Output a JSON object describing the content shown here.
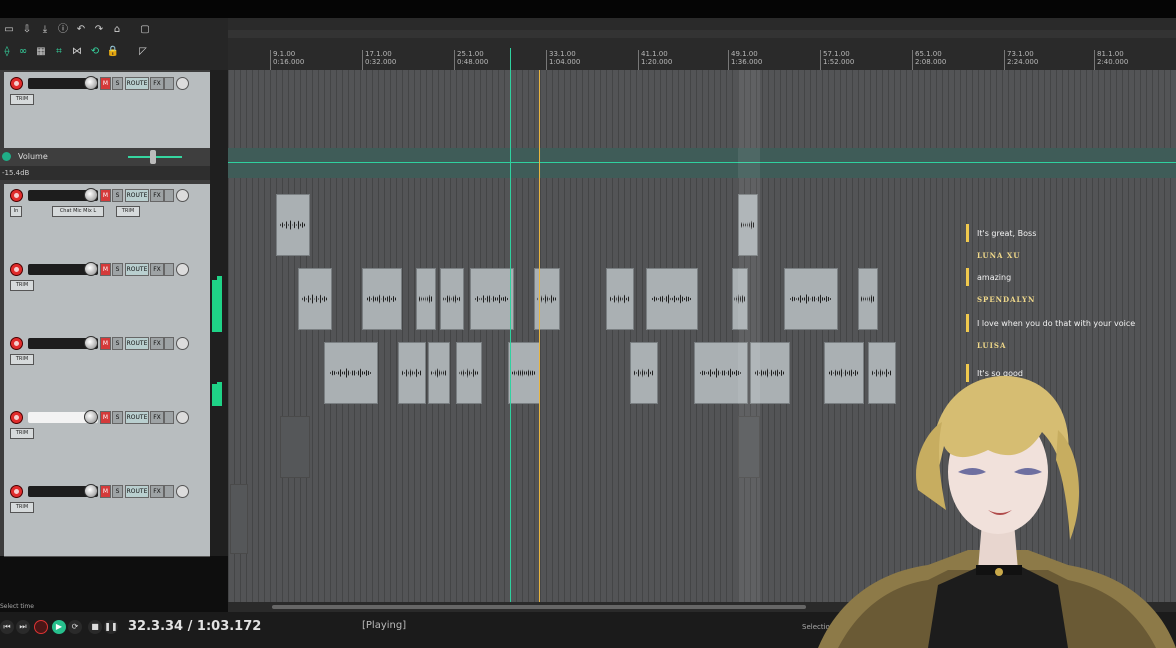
{
  "ruler": {
    "ticks": [
      {
        "bar": "9.1.00",
        "time": "0:16.000"
      },
      {
        "bar": "17.1.00",
        "time": "0:32.000"
      },
      {
        "bar": "25.1.00",
        "time": "0:48.000"
      },
      {
        "bar": "33.1.00",
        "time": "1:04.000"
      },
      {
        "bar": "41.1.00",
        "time": "1:20.000"
      },
      {
        "bar": "49.1.00",
        "time": "1:36.000"
      },
      {
        "bar": "57.1.00",
        "time": "1:52.000"
      },
      {
        "bar": "65.1.00",
        "time": "2:08.000"
      },
      {
        "bar": "73.1.00",
        "time": "2:24.000"
      },
      {
        "bar": "81.1.00",
        "time": "2:40.000"
      }
    ]
  },
  "tracks": {
    "envelope_label": "Volume",
    "envelope_db": "-15.4dB",
    "input_label": "In",
    "input_device": "Chat Mic Mix L",
    "btn_m": "M",
    "btn_s": "S",
    "btn_route": "ROUTE",
    "btn_fx": "FX",
    "btn_trim": "TRIM"
  },
  "transport": {
    "timecode": "32.3.34 / 1:03.172",
    "status": "[Playing]",
    "selection_label": "Selection",
    "select_time_hint": "Select time"
  },
  "chat": {
    "messages": [
      {
        "type": "text",
        "text": "It's great, Boss"
      },
      {
        "type": "name",
        "text": "LUNA XU"
      },
      {
        "type": "text",
        "text": "amazing"
      },
      {
        "type": "name",
        "text": "SPENDALYN"
      },
      {
        "type": "text",
        "text": "I love when you do that with your voice"
      },
      {
        "type": "name",
        "text": "LUISA"
      },
      {
        "type": "text",
        "text": "It's so good"
      }
    ]
  },
  "colors": {
    "accent_green": "#2fd19f",
    "edit_cursor": "#e8b540",
    "record_red": "#e02c2c",
    "chat_bar": "#f0c94d"
  }
}
